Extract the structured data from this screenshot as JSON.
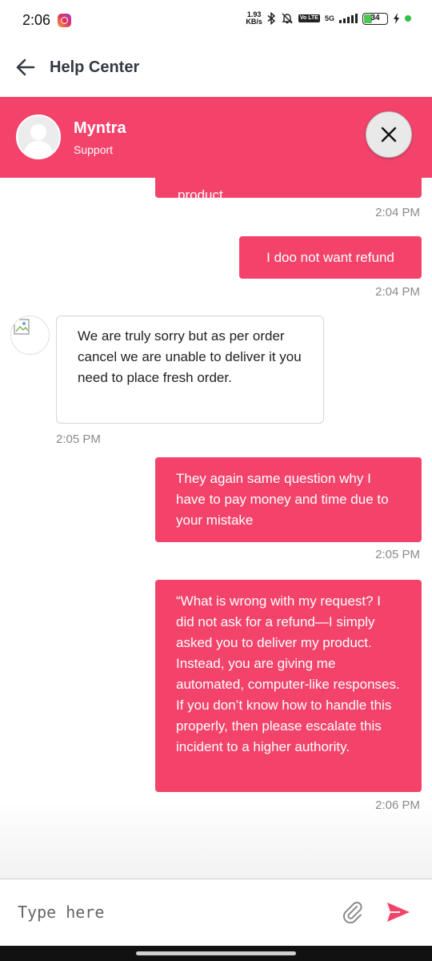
{
  "status_bar": {
    "time": "2:06",
    "net_speed_value": "1.93",
    "net_speed_unit": "KB/s",
    "volte": "Vo LTE",
    "network": "5G",
    "battery": "34",
    "battery_level": 0.34
  },
  "app_bar": {
    "title": "Help Center"
  },
  "agent": {
    "name": "Myntra",
    "role": "Support"
  },
  "messages": [
    {
      "sender": "me",
      "text": "product",
      "time": "2:04 PM"
    },
    {
      "sender": "me",
      "text": "I doo not want refund",
      "time": "2:04 PM"
    },
    {
      "sender": "them",
      "text": "We are truly sorry but as per order cancel we are unable to deliver it you need to place fresh order.",
      "time": "2:05 PM"
    },
    {
      "sender": "me",
      "text": "They again same question why I have to pay money and time due to your mistake",
      "time": "2:05 PM"
    },
    {
      "sender": "me",
      "text": "“What is wrong with my request? I did not ask for a refund—I simply asked you to deliver my product. Instead, you are giving me automated, computer-like responses. If you don’t know how to handle this properly, then please escalate this incident to a higher authority.",
      "time": "2:06 PM"
    }
  ],
  "input": {
    "placeholder": "Type here",
    "value": ""
  },
  "colors": {
    "accent": "#f3436b",
    "bubble_text": "#ffffff",
    "timestamp": "#8a8a8a"
  },
  "icons": [
    "back-arrow-icon",
    "close-icon",
    "attach-icon",
    "send-icon",
    "user-avatar-icon",
    "broken-image-icon"
  ]
}
